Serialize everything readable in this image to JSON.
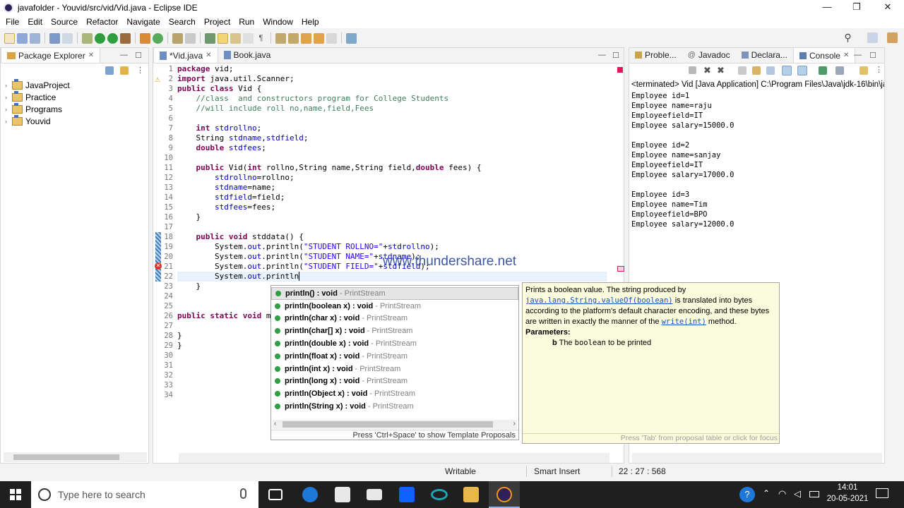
{
  "window": {
    "title": "javafolder - Youvid/src/vid/Vid.java - Eclipse IDE",
    "min": "—",
    "max": "❐",
    "close": "✕"
  },
  "menu": [
    "File",
    "Edit",
    "Source",
    "Refactor",
    "Navigate",
    "Search",
    "Project",
    "Run",
    "Window",
    "Help"
  ],
  "package_explorer": {
    "tab": "Package Explorer",
    "items": [
      "JavaProject",
      "Practice",
      "Programs",
      "Youvid"
    ]
  },
  "editor": {
    "tabs": [
      "*Vid.java",
      "Book.java"
    ],
    "lines": [
      "1",
      "2",
      "3",
      "4",
      "5",
      "6",
      "7",
      "8",
      "9",
      "10",
      "11",
      "12",
      "13",
      "14",
      "15",
      "16",
      "17",
      "18",
      "19",
      "20",
      "21",
      "22",
      "23",
      "24",
      "25",
      "26",
      "27",
      "28",
      "29",
      "30",
      "31",
      "32",
      "33",
      "34"
    ]
  },
  "watermark": "www.thundershare.net",
  "console": {
    "tabs": [
      "Proble...",
      "Javadoc",
      "Declara...",
      "Console"
    ],
    "header": "<terminated> Vid [Java Application] C:\\Program Files\\Java\\jdk-16\\bin\\ja",
    "lines": [
      "Employee id=1",
      "Employee name=raju",
      "Employeefield=IT",
      "Employee salary=15000.0",
      "",
      "Employee id=2",
      "Employee name=sanjay",
      "Employeefield=IT",
      "Employee salary=17000.0",
      "",
      "Employee id=3",
      "Employee name=Tim",
      "Employeefield=BPO",
      "Employee salary=12000.0"
    ]
  },
  "autocomplete": {
    "items": [
      {
        "sig": "println() : void",
        "owner": "PrintStream"
      },
      {
        "sig": "println(boolean x) : void",
        "owner": "PrintStream"
      },
      {
        "sig": "println(char x) : void",
        "owner": "PrintStream"
      },
      {
        "sig": "println(char[] x) : void",
        "owner": "PrintStream"
      },
      {
        "sig": "println(double x) : void",
        "owner": "PrintStream"
      },
      {
        "sig": "println(float x) : void",
        "owner": "PrintStream"
      },
      {
        "sig": "println(int x) : void",
        "owner": "PrintStream"
      },
      {
        "sig": "println(long x) : void",
        "owner": "PrintStream"
      },
      {
        "sig": "println(Object x) : void",
        "owner": "PrintStream"
      },
      {
        "sig": "println(String x) : void",
        "owner": "PrintStream"
      }
    ],
    "footer": "Press 'Ctrl+Space' to show Template Proposals"
  },
  "javadoc": {
    "p1": "Prints a boolean value. The string produced by",
    "link1": "java.lang.String.valueOf(boolean)",
    "p2": "is translated into bytes according to the platform's default character encoding, and these bytes are written in exactly the manner of the",
    "link2": "write(int)",
    "p3": "method.",
    "params_label": "Parameters:",
    "param_name": "b",
    "param_the": "The",
    "param_code": "boolean",
    "param_desc": "to be printed",
    "footer": "Press 'Tab' from proposal table or click for focus"
  },
  "status": {
    "writable": "Writable",
    "insert": "Smart Insert",
    "pos": "22 : 27 : 568"
  },
  "taskbar": {
    "search": "Type here to search",
    "time": "14:01",
    "date": "20-05-2021"
  },
  "colors": {
    "keyword": "#7f0055",
    "comment": "#3f7f5f",
    "string": "#2a00ff",
    "field": "#0000c0",
    "taskbar": "#1f1f1f"
  }
}
